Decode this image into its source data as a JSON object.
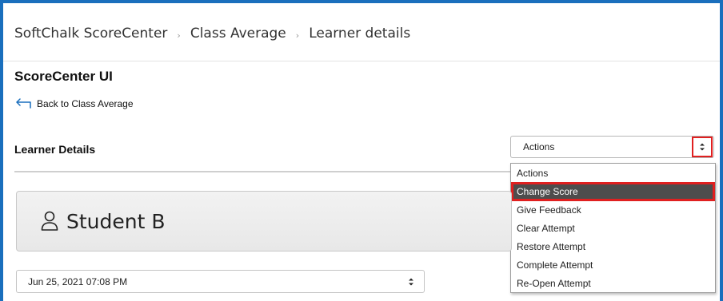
{
  "breadcrumb": {
    "items": [
      "SoftChalk ScoreCenter",
      "Class Average",
      "Learner details"
    ],
    "separator": "›"
  },
  "page_title": "ScoreCenter UI",
  "back_link": "Back to Class Average",
  "section_title": "Learner Details",
  "actions_select": {
    "value": "Actions",
    "options": [
      "Actions",
      "Change Score",
      "Give Feedback",
      "Clear Attempt",
      "Restore Attempt",
      "Complete Attempt",
      "Re-Open Attempt"
    ],
    "highlighted_option": "Change Score"
  },
  "student": {
    "name": "Student B",
    "icon": "user-icon"
  },
  "attempt_select": {
    "value": "Jun 25, 2021 07:08 PM"
  },
  "colors": {
    "frame": "#1a6fbd",
    "highlight_outline": "#e02020",
    "selected_bg": "#4d4d4d",
    "back_arrow": "#1a6fbd"
  }
}
